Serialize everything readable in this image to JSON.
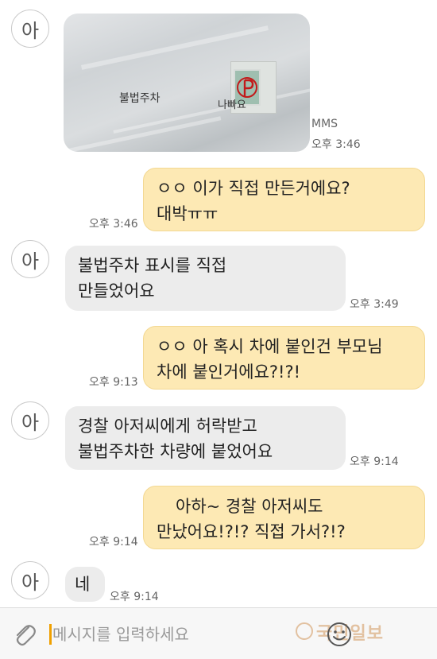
{
  "sender_avatar_initial": "아",
  "photo_message": {
    "sign_left_text": "불법주차",
    "sign_right_text": "나빠요",
    "type_label": "MMS",
    "time": "오후 3:46"
  },
  "messages": [
    {
      "direction": "out",
      "lines": [
        "ㅇㅇ 이가 직접 만든거에요?",
        "대박ㅠㅠ"
      ],
      "time": "오후 3:46"
    },
    {
      "direction": "in",
      "lines": [
        "불법주차 표시를 직접",
        "만들었어요"
      ],
      "time": "오후 3:49"
    },
    {
      "direction": "out",
      "lines": [
        "ㅇㅇ 아 혹시 차에 붙인건 부모님",
        "차에 붙인거에요?!?!"
      ],
      "time": "오후 9:13"
    },
    {
      "direction": "in",
      "lines": [
        "경찰 아저씨에게 허락받고",
        "불법주차한 차량에 붙었어요"
      ],
      "time": "오후 9:14"
    },
    {
      "direction": "out",
      "lines": [
        "아하~ 경찰 아저씨도",
        "만났어요!?!? 직접 가서?!?"
      ],
      "time": "오후 9:14"
    },
    {
      "direction": "in",
      "lines": [
        "네"
      ],
      "time": "오후 9:14"
    }
  ],
  "input_bar": {
    "placeholder": "메시지를 입력하세요",
    "watermark_text": "국민일보",
    "icons": [
      "attachment-icon",
      "emoji-icon"
    ]
  },
  "colors": {
    "incoming_bubble": "#ececec",
    "outgoing_bubble": "#fde9b4",
    "cursor": "#f0a000"
  }
}
